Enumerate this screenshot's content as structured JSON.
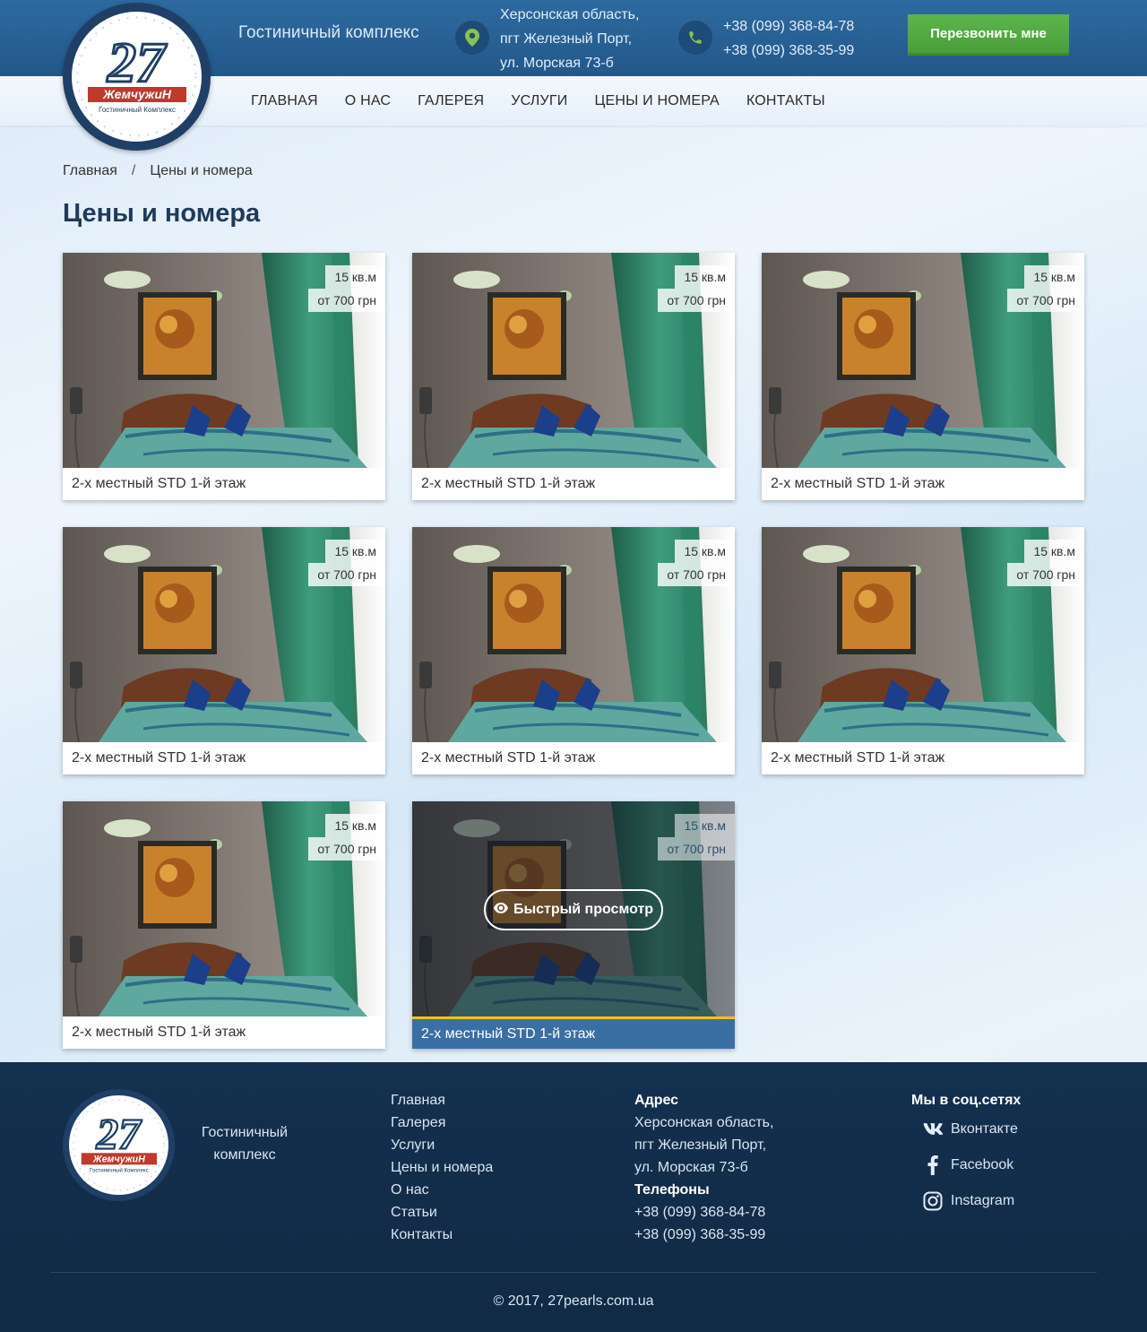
{
  "header": {
    "tagline": "Гостиничный комплекс",
    "address": [
      "Херсонская область,",
      "пгт Железный Порт,",
      "ул. Морская 73-б"
    ],
    "phones": [
      "+38 (099) 368-84-78",
      "+38 (099) 368-35-99"
    ],
    "callback_label": "Перезвонить мне",
    "logo_number": "27",
    "logo_name": "ЖемчужиН",
    "logo_sub": "Гостиничный Комплекс"
  },
  "nav": [
    "ГЛАВНАЯ",
    "О НАС",
    "ГАЛЕРЕЯ",
    "УСЛУГИ",
    "ЦЕНЫ И НОМЕРА",
    "КОНТАКТЫ"
  ],
  "breadcrumb": {
    "home": "Главная",
    "sep": "/",
    "current": "Цены и номера"
  },
  "page_title": "Цены и номера",
  "rooms": [
    {
      "title": "2-х местный STD 1-й этаж",
      "area": "15 кв.м",
      "price": "от 700 грн"
    },
    {
      "title": "2-х местный STD 1-й этаж",
      "area": "15 кв.м",
      "price": "от 700 грн"
    },
    {
      "title": "2-х местный STD 1-й этаж",
      "area": "15 кв.м",
      "price": "от 700 грн"
    },
    {
      "title": "2-х местный STD 1-й этаж",
      "area": "15 кв.м",
      "price": "от 700 грн"
    },
    {
      "title": "2-х местный STD 1-й этаж",
      "area": "15 кв.м",
      "price": "от 700 грн"
    },
    {
      "title": "2-х местный STD 1-й этаж",
      "area": "15 кв.м",
      "price": "от 700 грн"
    },
    {
      "title": "2-х местный STD 1-й этаж",
      "area": "15 кв.м",
      "price": "от 700 грн"
    },
    {
      "title": "2-х местный STD 1-й этаж",
      "area": "15 кв.м",
      "price": "от 700 грн"
    }
  ],
  "quick_view_label": "Быстрый просмотр",
  "footer": {
    "tagline": "Гостиничный комплекс",
    "links": [
      "Главная",
      "Галерея",
      "Услуги",
      "Цены и номера",
      "О нас",
      "Статьи",
      "Контакты"
    ],
    "address_heading": "Адрес",
    "address": [
      "Херсонская область,",
      "пгт Железный Порт,",
      "ул. Морская 73-б"
    ],
    "phones_heading": "Телефоны",
    "phones": [
      "+38 (099) 368-84-78",
      "+38 (099) 368-35-99"
    ],
    "social_heading": "Мы в соц.сетях",
    "social": [
      {
        "label": "Вконтакте",
        "icon": "vk-icon"
      },
      {
        "label": "Facebook",
        "icon": "facebook-icon"
      },
      {
        "label": "Instagram",
        "icon": "instagram-icon"
      }
    ],
    "copyright": "© 2017, 27pearls.com.ua"
  },
  "colors": {
    "header_blue": "#2d6aa0",
    "callback_green": "#5cb54a",
    "footer_navy": "#13304f",
    "title_blue": "#1e3a5c",
    "hover_caption": "#3a6fa3",
    "hover_accent": "#f1c40f"
  }
}
